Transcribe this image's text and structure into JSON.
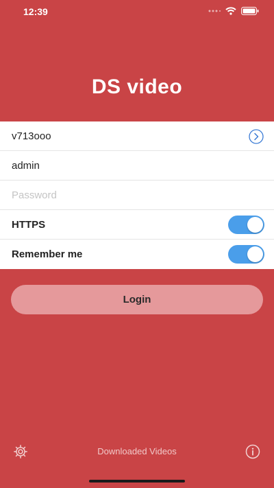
{
  "status_bar": {
    "time": "12:39",
    "icons": [
      "signal-dots-icon",
      "wifi-icon",
      "battery-icon"
    ]
  },
  "app": {
    "title": "DS video"
  },
  "form": {
    "server": {
      "value": "v713ooo",
      "action_icon": "arrow-circle-right-icon"
    },
    "username": {
      "value": "admin"
    },
    "password": {
      "value": "",
      "placeholder": "Password"
    },
    "https": {
      "label": "HTTPS",
      "enabled": true
    },
    "remember_me": {
      "label": "Remember me",
      "enabled": true
    }
  },
  "login_button": {
    "label": "Login"
  },
  "bottom_bar": {
    "settings_icon": "gear-icon",
    "downloaded_label": "Downloaded Videos",
    "info_icon": "info-icon"
  },
  "colors": {
    "background": "#c94446",
    "login_button": "#e5999b",
    "toggle_on": "#4a9eea",
    "accent": "#3a7bd5"
  }
}
